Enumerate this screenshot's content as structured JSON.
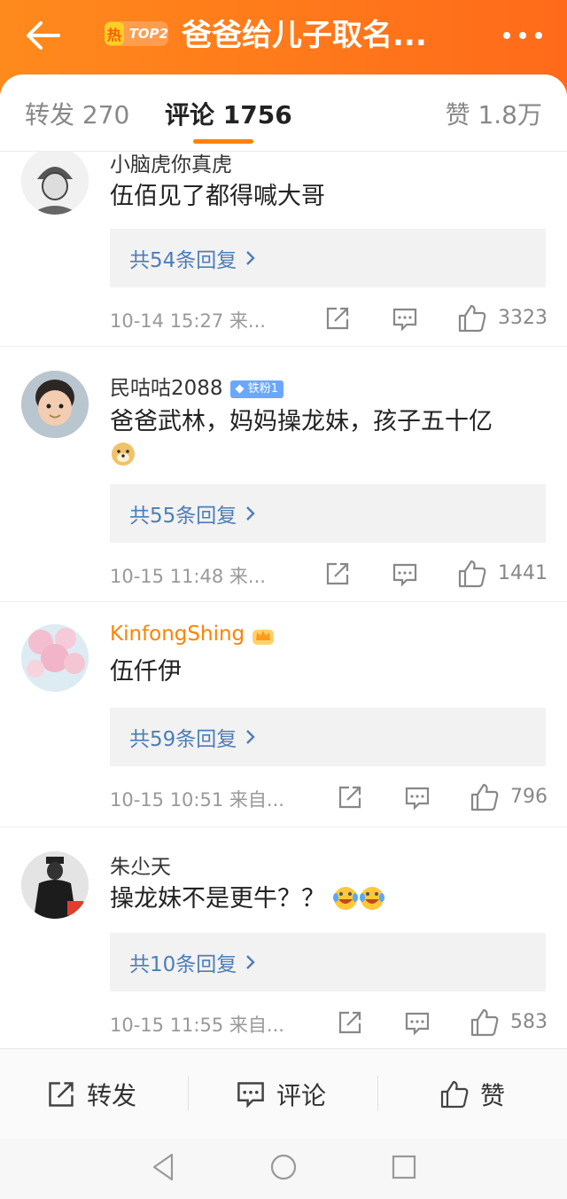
{
  "header": {
    "hot_icon_label": "热",
    "rank": "TOP2",
    "title": "爸爸给儿子取名...",
    "back_icon": "arrow-left-icon",
    "more_icon": "more-horizontal-icon"
  },
  "tabs": {
    "repost": "转发 270",
    "comment": "评论 1756",
    "like": "赞 1.8万"
  },
  "comments": [
    {
      "user": "小脑虎你真虎",
      "text": "伍佰见了都得喊大哥",
      "replies": "共54条回复",
      "meta": "10-14 15:27  来...",
      "likes": "3323"
    },
    {
      "user": "民咕咕2088",
      "badge": "铁粉1",
      "text": "爸爸武林，妈妈操龙妹，孩子五十亿",
      "replies": "共55条回复",
      "meta": "10-15 11:48  来...",
      "likes": "1441"
    },
    {
      "user": "KinfongShing",
      "text": "伍仟伊",
      "replies": "共59条回复",
      "meta": "10-15 10:51  来自...",
      "likes": "796"
    },
    {
      "user": "朱尐天",
      "text": "操龙妹不是更牛？？",
      "replies": "共10条回复",
      "meta": "10-15 11:55  来自...",
      "likes": "583"
    }
  ],
  "bottom_bar": {
    "repost": "转发",
    "comment": "评论",
    "like": "赞"
  },
  "colors": {
    "header": "#ff7f1a",
    "accent": "#ff8200",
    "link": "#4d7db8"
  }
}
